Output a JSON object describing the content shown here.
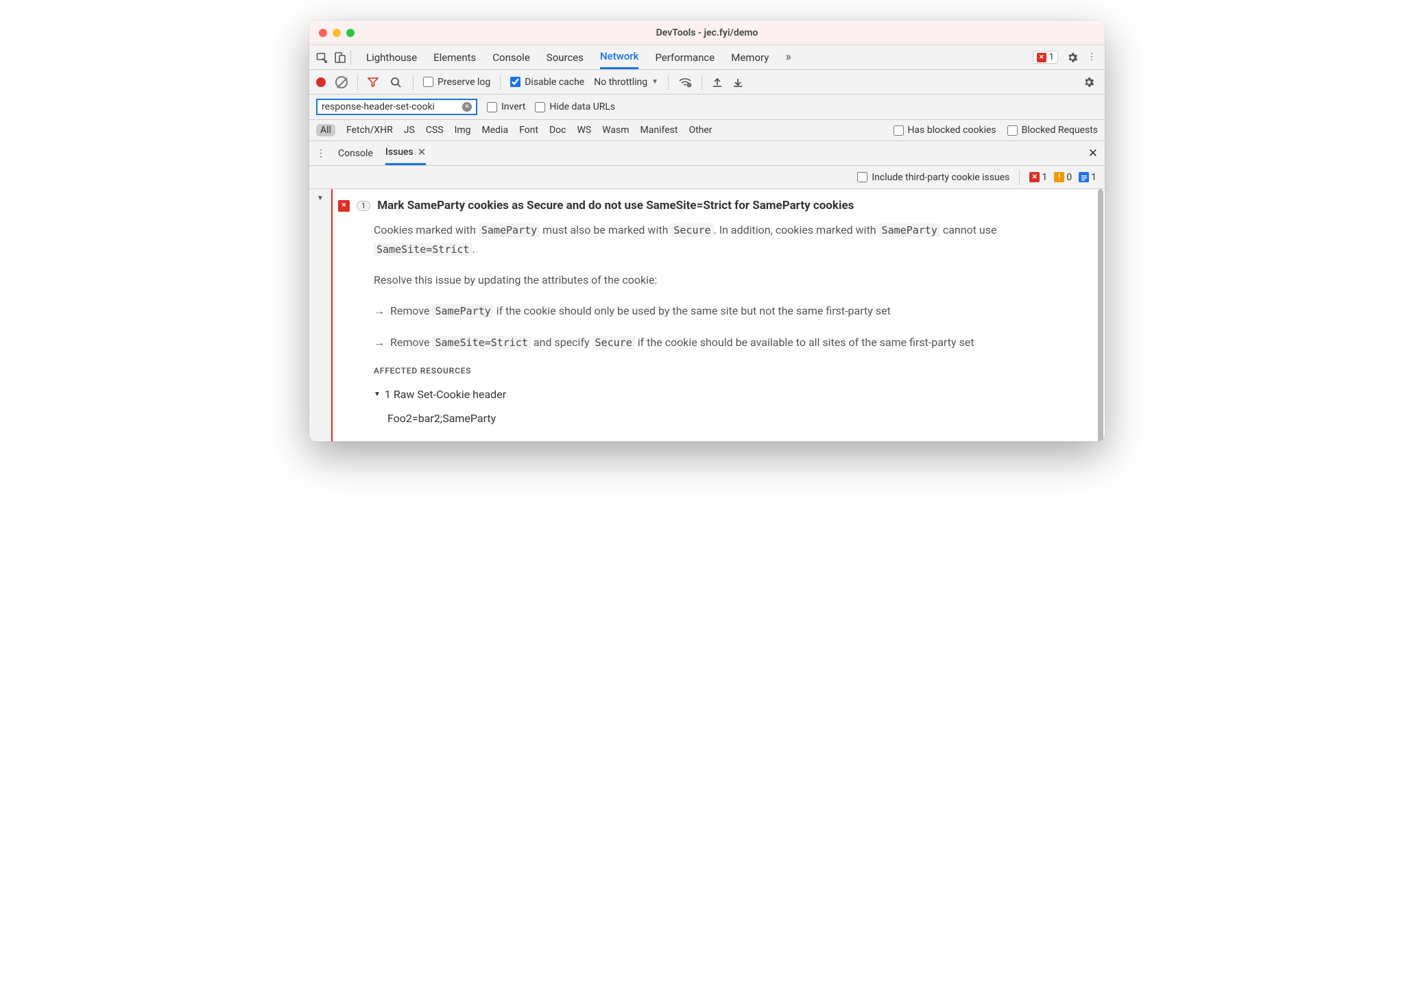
{
  "window": {
    "title": "DevTools - jec.fyi/demo"
  },
  "mainTabs": {
    "items": [
      "Lighthouse",
      "Elements",
      "Console",
      "Sources",
      "Network",
      "Performance",
      "Memory"
    ],
    "active": "Network",
    "errorCount": "1"
  },
  "netToolbar": {
    "preserveLog": {
      "label": "Preserve log",
      "checked": false
    },
    "disableCache": {
      "label": "Disable cache",
      "checked": true
    },
    "throttling": "No throttling"
  },
  "filterRow": {
    "value": "response-header-set-cooki",
    "invert": {
      "label": "Invert",
      "checked": false
    },
    "hideData": {
      "label": "Hide data URLs",
      "checked": false
    }
  },
  "typeRow": {
    "types": [
      "All",
      "Fetch/XHR",
      "JS",
      "CSS",
      "Img",
      "Media",
      "Font",
      "Doc",
      "WS",
      "Wasm",
      "Manifest",
      "Other"
    ],
    "selected": "All",
    "hasBlocked": {
      "label": "Has blocked cookies",
      "checked": false
    },
    "blockedReq": {
      "label": "Blocked Requests",
      "checked": false
    }
  },
  "drawer": {
    "tabs": [
      "Console",
      "Issues"
    ],
    "active": "Issues"
  },
  "issuesToolbar": {
    "includeThirdParty": {
      "label": "Include third-party cookie issues",
      "checked": false
    },
    "counts": {
      "error": "1",
      "warning": "0",
      "info": "1"
    }
  },
  "issue": {
    "count": "1",
    "title": "Mark SameParty cookies as Secure and do not use SameSite=Strict for SameParty cookies",
    "desc": {
      "p1a": "Cookies marked with ",
      "c1": "SameParty",
      "p1b": " must also be marked with ",
      "c2": "Secure",
      "p1c": ". In addition, cookies marked with ",
      "c3": "SameParty",
      "p1d": " cannot use ",
      "c4": "SameSite=Strict",
      "p1e": ".",
      "p2": "Resolve this issue by updating the attributes of the cookie:",
      "b1a": "Remove ",
      "b1c": "SameParty",
      "b1b": " if the cookie should only be used by the same site but not the same first-party set",
      "b2a": "Remove ",
      "b2c1": "SameSite=Strict",
      "b2b": " and specify ",
      "b2c2": "Secure",
      "b2c": " if the cookie should be available to all sites of the same first-party set"
    },
    "affected": {
      "label": "AFFECTED RESOURCES",
      "header": "1 Raw Set-Cookie header",
      "value": "Foo2=bar2;SameParty"
    }
  }
}
